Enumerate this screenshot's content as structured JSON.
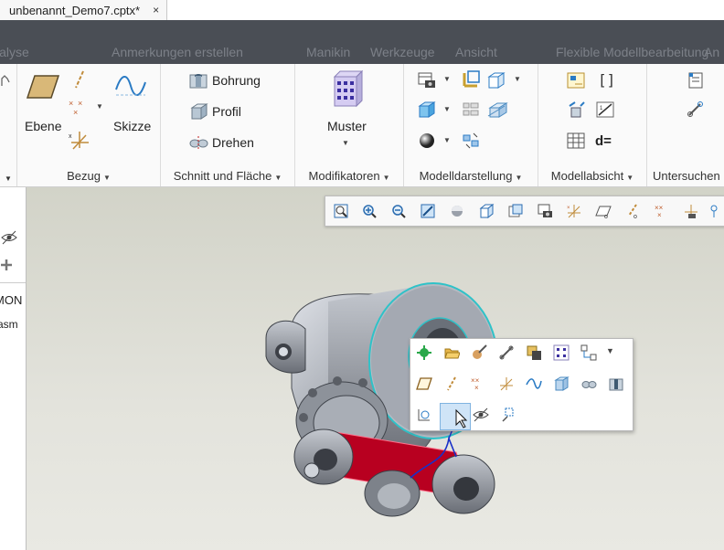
{
  "document_tab": {
    "title": "unbenannt_Demo7.cptx*",
    "close": "×"
  },
  "ribbon_tabs": [
    "Analyse",
    "Anmerkungen erstellen",
    "Manikin",
    "Werkzeuge",
    "Ansicht",
    "Flexible Modellbearbeitung",
    "An"
  ],
  "groups": {
    "bezug": {
      "label": "Bezug",
      "ebene_label": "Ebene",
      "skizze_label": "Skizze"
    },
    "schnitt": {
      "label": "Schnitt und Fläche",
      "bohrung_label": "Bohrung",
      "profil_label": "Profil",
      "drehen_label": "Drehen"
    },
    "modifikatoren": {
      "label": "Modifikatoren",
      "muster_label": "Muster"
    },
    "modelldarstellung": {
      "label": "Modelldarstellung"
    },
    "modellabsicht": {
      "label": "Modellabsicht",
      "param_label": "d="
    },
    "untersuchen": {
      "label": "Untersuchen"
    }
  },
  "left_panel": {
    "text1": "MON",
    "text2": "asm"
  },
  "colors": {
    "dark_bar": "#4a4e55",
    "viewport_top": "#d2d3c8",
    "selection_edge": "#2fc2c8",
    "selected_surface": "#b80020",
    "part_gray": "#9a9ea6"
  }
}
